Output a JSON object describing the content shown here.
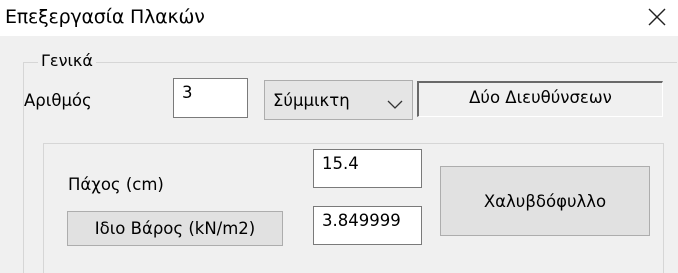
{
  "window": {
    "title": "Επεξεργασία Πλακών"
  },
  "general_group": {
    "legend": "Γενικά",
    "number_label": "Αριθμός",
    "number_value": "3",
    "type_select_value": "Σύμμικτη",
    "direction_text": "Δύο Διευθύνσεων"
  },
  "properties": {
    "thickness_label": "Πάχος (cm)",
    "thickness_value": "15.4",
    "self_weight_button": "Ιδιο Βάρος (kN/m2)",
    "self_weight_value": "3.849999",
    "steel_deck_button": "Χαλυβδόφυλλο"
  },
  "icons": {
    "close": "close-icon",
    "dropdown": "chevron-down-icon"
  },
  "colors": {
    "dialog_background": "#f0f0f0",
    "button_face": "#e1e1e1",
    "input_border": "#7a7a7a"
  }
}
